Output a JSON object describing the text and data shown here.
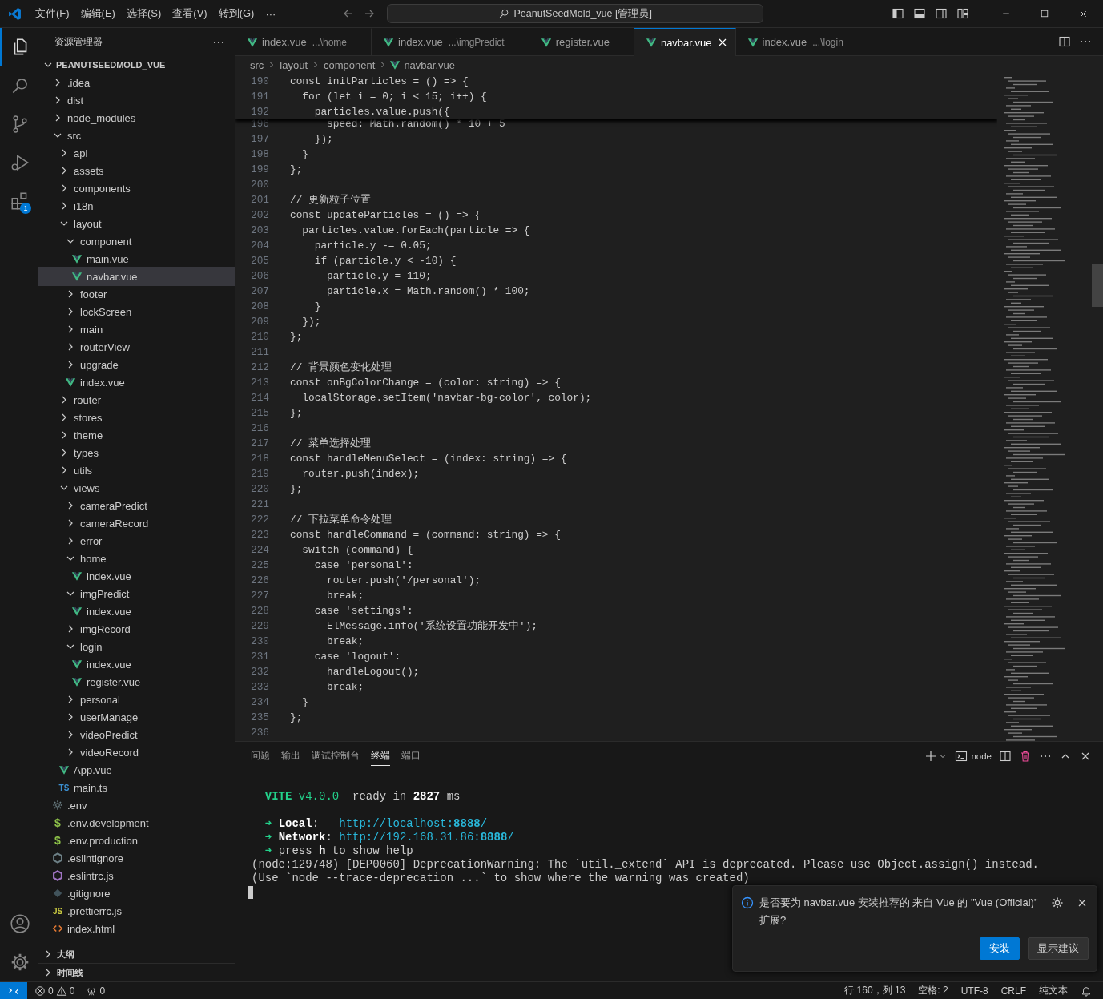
{
  "title_bar": {
    "menus": [
      "文件(F)",
      "编辑(E)",
      "选择(S)",
      "查看(V)",
      "转到(G)",
      "···"
    ],
    "search": "PeanutSeedMold_vue [管理员]"
  },
  "activity_bar": {
    "items": [
      {
        "kind": "explorer",
        "selected": true
      },
      {
        "kind": "search",
        "selected": false
      },
      {
        "kind": "source-control",
        "selected": false
      },
      {
        "kind": "run-debug",
        "selected": false
      },
      {
        "kind": "extensions",
        "selected": false,
        "badge": "1"
      }
    ],
    "bottom": [
      {
        "kind": "account"
      },
      {
        "kind": "settings"
      }
    ]
  },
  "sidebar": {
    "title": "资源管理器",
    "root": {
      "name": "PEANUTSEEDMOLD_VUE",
      "expanded": true,
      "children": [
        {
          "name": ".idea",
          "kind": "folder",
          "expanded": false,
          "selected": false
        },
        {
          "name": "dist",
          "kind": "folder",
          "expanded": false,
          "selected": false
        },
        {
          "name": "node_modules",
          "kind": "folder",
          "expanded": false,
          "selected": false
        },
        {
          "name": "src",
          "kind": "folder",
          "expanded": true,
          "selected": false,
          "children": [
            {
              "name": "api",
              "kind": "folder",
              "expanded": false,
              "selected": false
            },
            {
              "name": "assets",
              "kind": "folder",
              "expanded": false,
              "selected": false
            },
            {
              "name": "components",
              "kind": "folder",
              "expanded": false,
              "selected": false
            },
            {
              "name": "i18n",
              "kind": "folder",
              "expanded": false,
              "selected": false
            },
            {
              "name": "layout",
              "kind": "folder",
              "expanded": true,
              "selected": false,
              "children": [
                {
                  "name": "component",
                  "kind": "folder",
                  "expanded": true,
                  "selected": false,
                  "children": [
                    {
                      "name": "main.vue",
                      "kind": "vue",
                      "selected": false
                    },
                    {
                      "name": "navbar.vue",
                      "kind": "vue",
                      "selected": true
                    }
                  ]
                },
                {
                  "name": "footer",
                  "kind": "folder",
                  "expanded": false,
                  "selected": false
                },
                {
                  "name": "lockScreen",
                  "kind": "folder",
                  "expanded": false,
                  "selected": false
                },
                {
                  "name": "main",
                  "kind": "folder",
                  "expanded": false,
                  "selected": false
                },
                {
                  "name": "routerView",
                  "kind": "folder",
                  "expanded": false,
                  "selected": false
                },
                {
                  "name": "upgrade",
                  "kind": "folder",
                  "expanded": false,
                  "selected": false
                },
                {
                  "name": "index.vue",
                  "kind": "vue",
                  "selected": false
                }
              ]
            },
            {
              "name": "router",
              "kind": "folder",
              "expanded": false,
              "selected": false
            },
            {
              "name": "stores",
              "kind": "folder",
              "expanded": false,
              "selected": false
            },
            {
              "name": "theme",
              "kind": "folder",
              "expanded": false,
              "selected": false
            },
            {
              "name": "types",
              "kind": "folder",
              "expanded": false,
              "selected": false
            },
            {
              "name": "utils",
              "kind": "folder",
              "expanded": false,
              "selected": false
            },
            {
              "name": "views",
              "kind": "folder",
              "expanded": true,
              "selected": false,
              "children": [
                {
                  "name": "cameraPredict",
                  "kind": "folder",
                  "expanded": false,
                  "selected": false
                },
                {
                  "name": "cameraRecord",
                  "kind": "folder",
                  "expanded": false,
                  "selected": false
                },
                {
                  "name": "error",
                  "kind": "folder",
                  "expanded": false,
                  "selected": false
                },
                {
                  "name": "home",
                  "kind": "folder",
                  "expanded": true,
                  "selected": false,
                  "children": [
                    {
                      "name": "index.vue",
                      "kind": "vue",
                      "selected": false
                    }
                  ]
                },
                {
                  "name": "imgPredict",
                  "kind": "folder",
                  "expanded": true,
                  "selected": false,
                  "children": [
                    {
                      "name": "index.vue",
                      "kind": "vue",
                      "selected": false
                    }
                  ]
                },
                {
                  "name": "imgRecord",
                  "kind": "folder",
                  "expanded": false,
                  "selected": false
                },
                {
                  "name": "login",
                  "kind": "folder",
                  "expanded": true,
                  "selected": false,
                  "children": [
                    {
                      "name": "index.vue",
                      "kind": "vue",
                      "selected": false
                    },
                    {
                      "name": "register.vue",
                      "kind": "vue",
                      "selected": false
                    }
                  ]
                },
                {
                  "name": "personal",
                  "kind": "folder",
                  "expanded": false,
                  "selected": false
                },
                {
                  "name": "userManage",
                  "kind": "folder",
                  "expanded": false,
                  "selected": false
                },
                {
                  "name": "videoPredict",
                  "kind": "folder",
                  "expanded": false,
                  "selected": false
                },
                {
                  "name": "videoRecord",
                  "kind": "folder",
                  "expanded": false,
                  "selected": false
                }
              ]
            },
            {
              "name": "App.vue",
              "kind": "vue",
              "selected": false
            },
            {
              "name": "main.ts",
              "kind": "ts",
              "icon_label": "TS",
              "selected": false
            }
          ]
        },
        {
          "name": ".env",
          "kind": "gear",
          "selected": false
        },
        {
          "name": ".env.development",
          "kind": "dollar",
          "icon_label": "$",
          "selected": false
        },
        {
          "name": ".env.production",
          "kind": "dollar",
          "icon_label": "$",
          "selected": false
        },
        {
          "name": ".eslintignore",
          "kind": "eslintignore",
          "selected": false
        },
        {
          "name": ".eslintrc.js",
          "kind": "eslint",
          "selected": false
        },
        {
          "name": ".gitignore",
          "kind": "git",
          "selected": false
        },
        {
          "name": ".prettierrc.js",
          "kind": "js",
          "icon_label": "JS",
          "selected": false
        },
        {
          "name": "index.html",
          "kind": "html",
          "selected": false
        }
      ]
    },
    "sections": [
      {
        "title": "大纲",
        "expanded": false
      },
      {
        "title": "时间线",
        "expanded": false
      }
    ]
  },
  "editor": {
    "tabs": [
      {
        "label": "index.vue",
        "description": "...\\home",
        "selected": false
      },
      {
        "label": "index.vue",
        "description": "...\\imgPredict",
        "selected": false
      },
      {
        "label": "register.vue",
        "selected": false
      },
      {
        "label": "navbar.vue",
        "selected": true
      },
      {
        "label": "index.vue",
        "description": "...\\login",
        "selected": false
      }
    ],
    "breadcrumbs": [
      "src",
      "layout",
      "component",
      "navbar.vue"
    ],
    "sticky_lines": [
      {
        "n": "190",
        "code": "const initParticles = () => {"
      },
      {
        "n": "191",
        "code": "  for (let i = 0; i < 15; i++) {"
      },
      {
        "n": "192",
        "code": "    particles.value.push({"
      }
    ],
    "lines": [
      {
        "n": "196",
        "code": "      speed: Math.random() * 10 + 5"
      },
      {
        "n": "197",
        "code": "    });"
      },
      {
        "n": "198",
        "code": "  }"
      },
      {
        "n": "199",
        "code": "};"
      },
      {
        "n": "200"
      },
      {
        "n": "201",
        "code": "// 更新粒子位置"
      },
      {
        "n": "202",
        "code": "const updateParticles = () => {"
      },
      {
        "n": "203",
        "code": "  particles.value.forEach(particle => {"
      },
      {
        "n": "204",
        "code": "    particle.y -= 0.05;"
      },
      {
        "n": "205",
        "code": "    if (particle.y < -10) {"
      },
      {
        "n": "206",
        "code": "      particle.y = 110;"
      },
      {
        "n": "207",
        "code": "      particle.x = Math.random() * 100;"
      },
      {
        "n": "208",
        "code": "    }"
      },
      {
        "n": "209",
        "code": "  });"
      },
      {
        "n": "210",
        "code": "};"
      },
      {
        "n": "211"
      },
      {
        "n": "212",
        "code": "// 背景颜色变化处理"
      },
      {
        "n": "213",
        "code": "const onBgColorChange = (color: string) => {"
      },
      {
        "n": "214",
        "code": "  localStorage.setItem('navbar-bg-color', color);"
      },
      {
        "n": "215",
        "code": "};"
      },
      {
        "n": "216"
      },
      {
        "n": "217",
        "code": "// 菜单选择处理"
      },
      {
        "n": "218",
        "code": "const handleMenuSelect = (index: string) => {"
      },
      {
        "n": "219",
        "code": "  router.push(index);"
      },
      {
        "n": "220",
        "code": "};"
      },
      {
        "n": "221"
      },
      {
        "n": "222",
        "code": "// 下拉菜单命令处理"
      },
      {
        "n": "223",
        "code": "const handleCommand = (command: string) => {"
      },
      {
        "n": "224",
        "code": "  switch (command) {"
      },
      {
        "n": "225",
        "code": "    case 'personal':"
      },
      {
        "n": "226",
        "code": "      router.push('/personal');"
      },
      {
        "n": "227",
        "code": "      break;"
      },
      {
        "n": "228",
        "code": "    case 'settings':"
      },
      {
        "n": "229",
        "code": "      ElMessage.info('系统设置功能开发中');"
      },
      {
        "n": "230",
        "code": "      break;"
      },
      {
        "n": "231",
        "code": "    case 'logout':"
      },
      {
        "n": "232",
        "code": "      handleLogout();"
      },
      {
        "n": "233",
        "code": "      break;"
      },
      {
        "n": "234",
        "code": "  }"
      },
      {
        "n": "235",
        "code": "};"
      },
      {
        "n": "236"
      }
    ]
  },
  "panel": {
    "tabs": [
      {
        "label": "问题",
        "selected": false
      },
      {
        "label": "输出",
        "selected": false
      },
      {
        "label": "调试控制台",
        "selected": false
      },
      {
        "label": "终端",
        "selected": true
      },
      {
        "label": "端口",
        "selected": false
      }
    ],
    "terminal_name": "node",
    "terminal_lines": [
      {
        "kind": "indented",
        "segments": [
          {
            "text": "VITE",
            "kind": "brand"
          },
          {
            "text": " v4.0.0",
            "kind": "version"
          },
          {
            "text": "  ready in "
          },
          {
            "text": "2827",
            "kind": "number"
          },
          {
            "text": " ms"
          }
        ]
      },
      {
        "kind": "blank"
      },
      {
        "kind": "indented",
        "segments": [
          {
            "text": "➜ ",
            "kind": "arrow"
          },
          {
            "text": "Local",
            "kind": "label"
          },
          {
            "text": ":   "
          },
          {
            "text": "http://localhost:",
            "kind": "url"
          },
          {
            "text": "8888",
            "kind": "port"
          },
          {
            "text": "/",
            "kind": "url"
          }
        ]
      },
      {
        "kind": "indented",
        "segments": [
          {
            "text": "➜ ",
            "kind": "arrow"
          },
          {
            "text": "Network",
            "kind": "label"
          },
          {
            "text": ": "
          },
          {
            "text": "http://192.168.31.86:",
            "kind": "url"
          },
          {
            "text": "8888",
            "kind": "port"
          },
          {
            "text": "/",
            "kind": "url"
          }
        ]
      },
      {
        "kind": "indented",
        "segments": [
          {
            "text": "➜ ",
            "kind": "arrow"
          },
          {
            "text": "press "
          },
          {
            "text": "h",
            "kind": "label"
          },
          {
            "text": " to show help"
          }
        ]
      },
      {
        "kind": "text",
        "segments": [
          {
            "text": "(node:129748) [DEP0060] DeprecationWarning: The `util._extend` API is deprecated. Please use Object.assign() instead."
          }
        ]
      },
      {
        "kind": "text",
        "segments": [
          {
            "text": "(Use `node --trace-deprecation ...` to show where the warning was created)"
          }
        ]
      },
      {
        "kind": "cursor"
      }
    ]
  },
  "notification": {
    "message": "是否要为 navbar.vue 安装推荐的 来自 Vue 的 \"Vue (Official)\" 扩展?",
    "buttons": [
      {
        "label": "安装",
        "primary": true
      },
      {
        "label": "显示建议",
        "primary": false
      }
    ]
  },
  "status_bar": {
    "errors": "0",
    "warnings": "0",
    "ports": "0",
    "items": [
      "行 160，列 13",
      "空格: 2",
      "UTF-8",
      "CRLF",
      "纯文本"
    ]
  }
}
